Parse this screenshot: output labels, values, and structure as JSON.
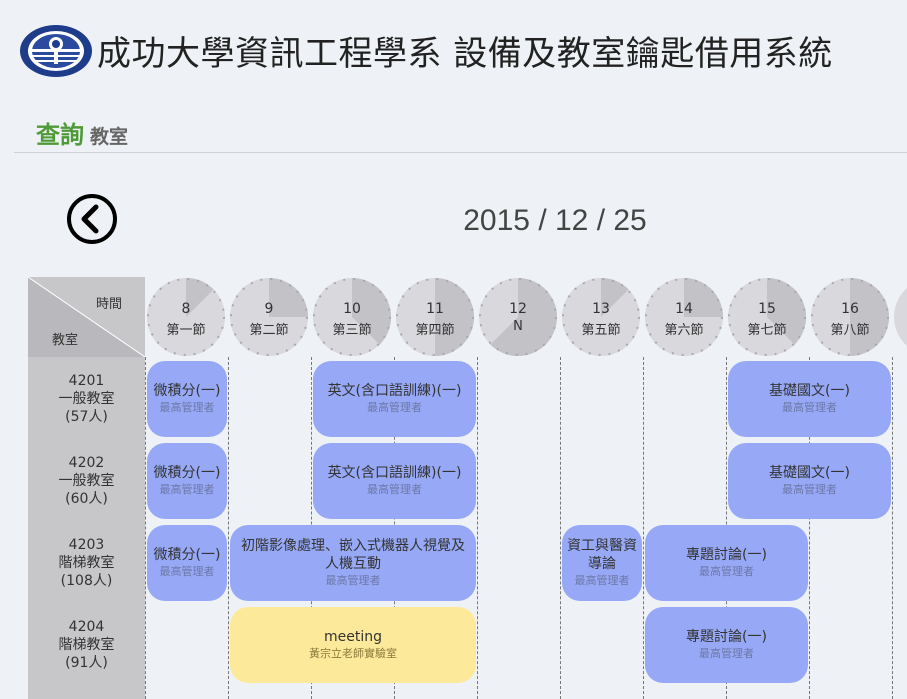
{
  "header": {
    "title": "成功大學資訊工程學系 設備及教室鑰匙借用系統"
  },
  "section": {
    "main": "查詢",
    "sub": "教室"
  },
  "date": "2015 / 12 / 25",
  "grid": {
    "corner_time": "時間",
    "corner_room": "教室"
  },
  "periods": [
    {
      "num": "8",
      "name": "第一節"
    },
    {
      "num": "9",
      "name": "第二節"
    },
    {
      "num": "10",
      "name": "第三節"
    },
    {
      "num": "11",
      "name": "第四節"
    },
    {
      "num": "12",
      "name": "N"
    },
    {
      "num": "13",
      "name": "第五節"
    },
    {
      "num": "14",
      "name": "第六節"
    },
    {
      "num": "15",
      "name": "第七節"
    },
    {
      "num": "16",
      "name": "第八節"
    }
  ],
  "rooms": [
    {
      "id": "4201",
      "type": "一般教室",
      "cap": "(57人)"
    },
    {
      "id": "4202",
      "type": "一般教室",
      "cap": "(60人)"
    },
    {
      "id": "4203",
      "type": "階梯教室",
      "cap": "(108人)"
    },
    {
      "id": "4204",
      "type": "階梯教室",
      "cap": "(91人)"
    }
  ],
  "bookings": [
    {
      "title": "微積分(一)",
      "owner": "最高管理者",
      "color": "#97a9f6"
    },
    {
      "title": "英文(含口語訓練)(一)",
      "owner": "最高管理者",
      "color": "#97a9f6"
    },
    {
      "title": "基礎國文(一)",
      "owner": "最高管理者",
      "color": "#97a9f6"
    },
    {
      "title": "微積分(一)",
      "owner": "最高管理者",
      "color": "#97a9f6"
    },
    {
      "title": "英文(含口語訓練)(一)",
      "owner": "最高管理者",
      "color": "#97a9f6"
    },
    {
      "title": "基礎國文(一)",
      "owner": "最高管理者",
      "color": "#97a9f6"
    },
    {
      "title": "微積分(一)",
      "owner": "最高管理者",
      "color": "#97a9f6"
    },
    {
      "title": "初階影像處理、嵌入式機器人視覺及人機互動",
      "owner": "最高管理者",
      "color": "#97a9f6"
    },
    {
      "title": "資工與醫資導論",
      "owner": "最高管理者",
      "color": "#97a9f6"
    },
    {
      "title": "專題討論(一)",
      "owner": "最高管理者",
      "color": "#97a9f6"
    },
    {
      "title": "meeting",
      "owner": "黃宗立老師實驗室",
      "color": "#fde99a"
    },
    {
      "title": "專題討論(一)",
      "owner": "最高管理者",
      "color": "#97a9f6"
    }
  ]
}
